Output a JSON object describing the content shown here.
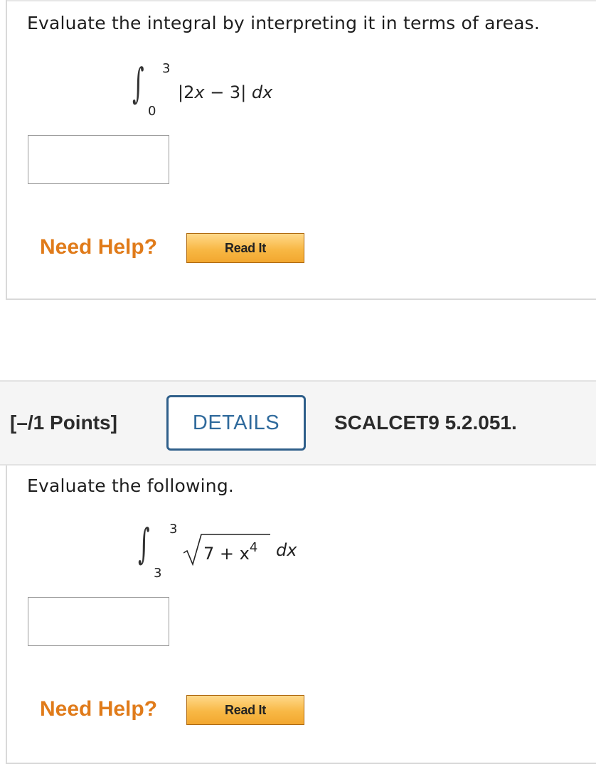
{
  "q1": {
    "prompt": "Evaluate the integral by interpreting it in terms of areas.",
    "upper": "3",
    "lower": "0",
    "expr_left": "|2",
    "expr_var": "x",
    "expr_right": " − 3| ",
    "expr_dx": "dx",
    "answer_value": "",
    "need_help": "Need Help?",
    "read_it": "Read It"
  },
  "q2": {
    "points": "[–/1 Points]",
    "details": "DETAILS",
    "reference": "SCALCET9 5.2.051.",
    "prompt": "Evaluate the following.",
    "upper": "3",
    "lower": "3",
    "radicand_const": "7 + ",
    "radicand_var": "x",
    "radicand_exp": "4",
    "expr_dx": "dx",
    "answer_value": "",
    "need_help": "Need Help?",
    "read_it": "Read It"
  }
}
